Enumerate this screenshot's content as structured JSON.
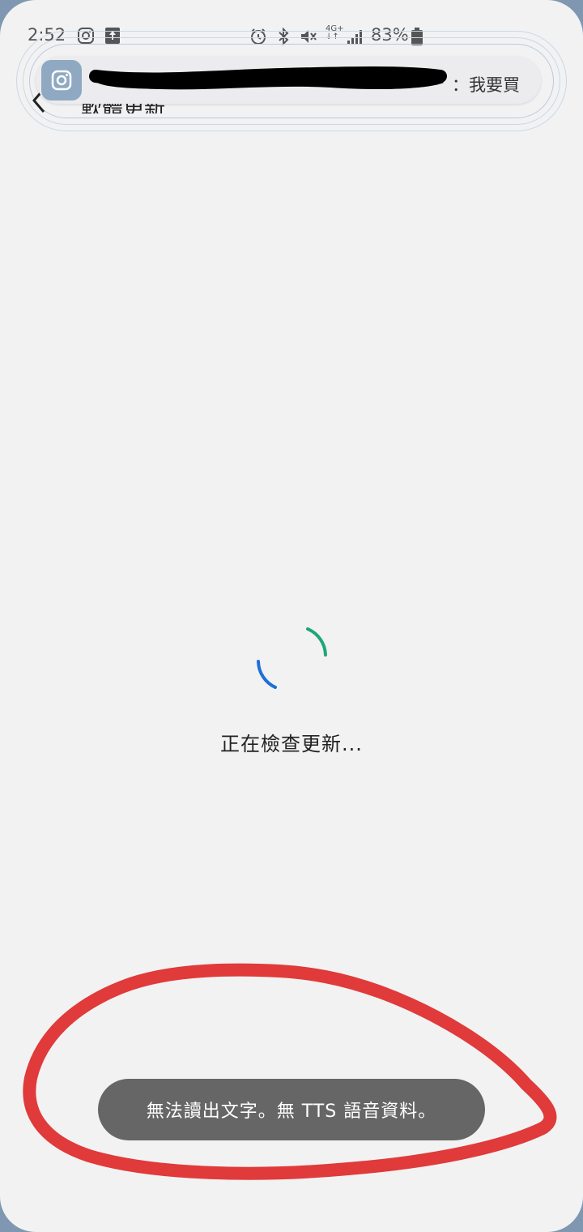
{
  "status_bar": {
    "time": "2:52",
    "battery": "83%",
    "network": "4G+",
    "icons": [
      "instagram-icon",
      "upload-icon",
      "alarm-icon",
      "bluetooth-icon",
      "mute-icon",
      "data-icon",
      "signal-icon",
      "battery-icon"
    ]
  },
  "notification": {
    "app_icon": "instagram-icon",
    "text_visible": "：我要買",
    "redacted": true
  },
  "page": {
    "title": "軟體更新"
  },
  "loading": {
    "message": "正在檢查更新..."
  },
  "toast": {
    "message": "無法讀出文字。無 TTS 語音資料。"
  },
  "colors": {
    "spinner_green": "#1fa67a",
    "spinner_blue": "#1f6fd8",
    "annotation_red": "#e03a3a",
    "toast_bg": "#666666"
  }
}
